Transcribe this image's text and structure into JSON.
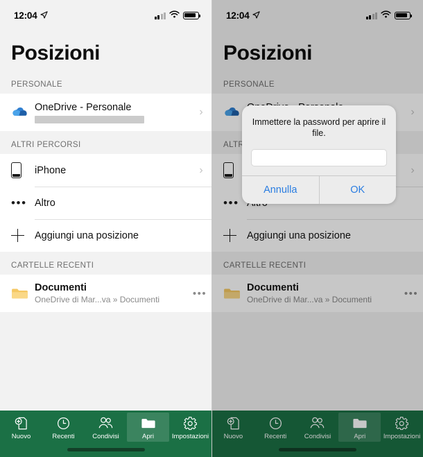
{
  "status_bar": {
    "time": "12:04",
    "location_icon": "location-arrow-icon",
    "signal_icon": "cellular-signal-icon",
    "wifi_icon": "wifi-icon",
    "battery_icon": "battery-icon"
  },
  "screen": {
    "title": "Posizioni",
    "sections": [
      {
        "header": "PERSONALE",
        "items": [
          {
            "icon": "onedrive-cloud-icon",
            "title": "OneDrive - Personale",
            "subtitle_redacted": true,
            "chevron": "›"
          }
        ]
      },
      {
        "header": "ALTRI PERCORSI",
        "items": [
          {
            "icon": "iphone-icon",
            "title": "iPhone",
            "chevron": "›"
          },
          {
            "icon": "ellipsis-icon",
            "title": "Altro"
          },
          {
            "icon": "plus-icon",
            "title": "Aggiungi una posizione"
          }
        ]
      },
      {
        "header": "CARTELLE RECENTI",
        "items": [
          {
            "icon": "folder-icon",
            "title": "Documenti",
            "subtitle": "OneDrive di Mar...va » Documenti",
            "more": "•••"
          }
        ]
      }
    ]
  },
  "tabbar": {
    "background_color": "#1b7045",
    "active_index": 3,
    "tabs": [
      {
        "label": "Nuovo",
        "icon": "new-document-icon"
      },
      {
        "label": "Recenti",
        "icon": "clock-icon"
      },
      {
        "label": "Condivisi",
        "icon": "people-icon"
      },
      {
        "label": "Apri",
        "icon": "folder-icon"
      },
      {
        "label": "Impostazioni",
        "icon": "gear-icon"
      }
    ]
  },
  "dialog": {
    "message": "Immettere la password per aprire il file.",
    "input_value": "",
    "input_placeholder": "",
    "cancel_label": "Annulla",
    "confirm_label": "OK",
    "accent_color": "#2a7de1"
  }
}
